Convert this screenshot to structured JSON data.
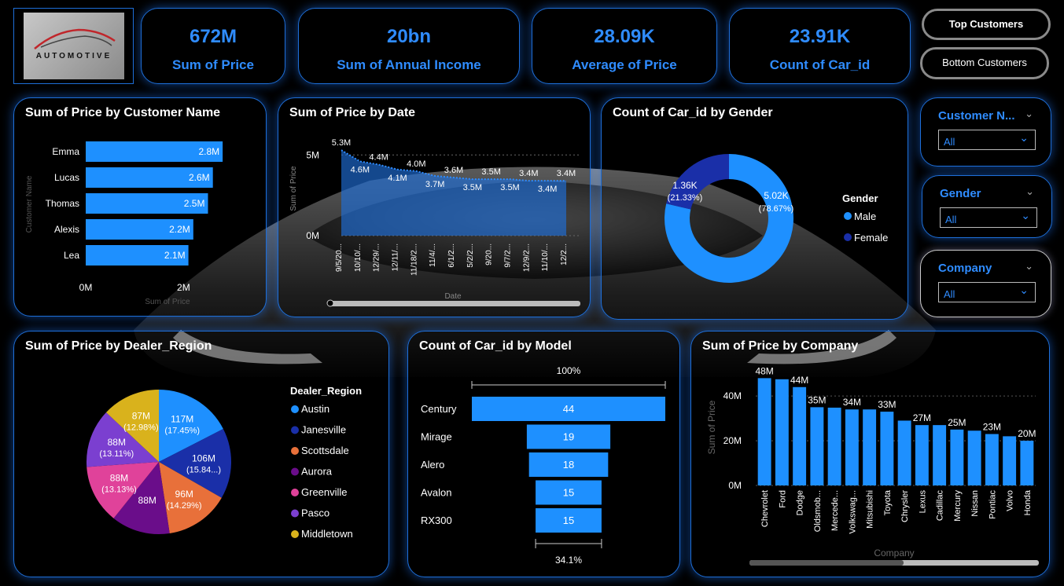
{
  "brand": {
    "logo_text": "AUTOMOTIVE"
  },
  "kpis": [
    {
      "value": "672M",
      "label": "Sum of Price"
    },
    {
      "value": "20bn",
      "label": "Sum of Annual Income"
    },
    {
      "value": "28.09K",
      "label": "Average of Price"
    },
    {
      "value": "23.91K",
      "label": "Count of Car_id"
    }
  ],
  "buttons": {
    "top_customers": "Top Customers",
    "bottom_customers": "Bottom Customers"
  },
  "slicers": [
    {
      "title": "Customer N...",
      "value": "All"
    },
    {
      "title": "Gender",
      "value": "All"
    },
    {
      "title": "Company",
      "value": "All"
    }
  ],
  "colors": {
    "accent": "#2f8cff",
    "bar": "#1e90ff",
    "border": "#1e6fd9"
  },
  "chart_data": [
    {
      "id": "customer",
      "type": "bar",
      "orientation": "horizontal",
      "title": "Sum of Price by Customer Name",
      "xlabel": "Sum of Price",
      "ylabel": "Customer Name",
      "categories": [
        "Emma",
        "Lucas",
        "Thomas",
        "Alexis",
        "Lea"
      ],
      "values": [
        2.8,
        2.6,
        2.5,
        2.2,
        2.1
      ],
      "labels": [
        "2.8M",
        "2.6M",
        "2.5M",
        "2.2M",
        "2.1M"
      ],
      "ticks": [
        "0M",
        "2M"
      ],
      "xlim": [
        0,
        3.2
      ]
    },
    {
      "id": "date",
      "type": "area",
      "title": "Sum of Price by Date",
      "xlabel": "Date",
      "ylabel": "Sum of Price",
      "values": [
        5.3,
        4.6,
        4.4,
        4.1,
        4.0,
        3.7,
        3.6,
        3.5,
        3.5,
        3.5,
        3.4,
        3.4,
        3.4
      ],
      "labels": [
        "5.3M",
        "4.6M",
        "4.4M",
        "4.1M",
        "4.0M",
        "3.7M",
        "3.6M",
        "3.5M",
        "3.5M",
        "3.5M",
        "3.4M",
        "3.4M",
        "3.4M"
      ],
      "x_ticks": [
        "9/5/20...",
        "10/10/...",
        "12/29/...",
        "12/11/...",
        "11/18/2...",
        "11/4/...",
        "6/1/2...",
        "5/2/2...",
        "9/20...",
        "9/7/2...",
        "12/9/2...",
        "11/10/...",
        "12/2..."
      ],
      "y_ticks": [
        "5M",
        "0M"
      ],
      "ylim": [
        0,
        5.5
      ]
    },
    {
      "id": "gender",
      "type": "pie",
      "variant": "donut",
      "title": "Count of Car_id by Gender",
      "legend_title": "Gender",
      "categories": [
        "Male",
        "Female"
      ],
      "values": [
        5.02,
        1.36
      ],
      "labels": [
        "5.02K",
        "1.36K"
      ],
      "percents": [
        "(78.67%)",
        "(21.33%)"
      ],
      "colors": [
        "#1e90ff",
        "#1a2fa8"
      ]
    },
    {
      "id": "region",
      "type": "pie",
      "title": "Sum of Price by Dealer_Region",
      "legend_title": "Dealer_Region",
      "categories": [
        "Austin",
        "Janesville",
        "Scottsdale",
        "Aurora",
        "Greenville",
        "Pasco",
        "Middletown"
      ],
      "values": [
        117,
        106,
        96,
        88,
        88,
        88,
        87
      ],
      "labels": [
        "117M",
        "106M",
        "96M",
        "88M",
        "88M",
        "88M",
        "87M"
      ],
      "percents": [
        "(17.45%)",
        "(15.84...)",
        "(14.29%)",
        "",
        "(13.13%)",
        "(13.11%)",
        "(12.98%)"
      ],
      "colors": [
        "#1e90ff",
        "#1a2fa8",
        "#e8703a",
        "#6a0d8a",
        "#e0429a",
        "#7b3fd0",
        "#d9b21c"
      ]
    },
    {
      "id": "model",
      "type": "bar",
      "variant": "funnel",
      "title": "Count of Car_id by Model",
      "categories": [
        "Century",
        "Mirage",
        "Alero",
        "Avalon",
        "RX300"
      ],
      "values": [
        44,
        19,
        18,
        15,
        15
      ],
      "top_label": "100%",
      "bottom_label": "34.1%"
    },
    {
      "id": "company",
      "type": "bar",
      "title": "Sum of Price by Company",
      "xlabel": "Company",
      "ylabel": "Sum of Price",
      "categories": [
        "Chevrolet",
        "Ford",
        "Dodge",
        "Oldsmob...",
        "Mercede...",
        "Volkswag...",
        "Mitsubishi",
        "Toyota",
        "Chrysler",
        "Lexus",
        "Cadillac",
        "Mercury",
        "Nissan",
        "Pontiac",
        "Volvo",
        "Honda"
      ],
      "values": [
        48,
        47.5,
        44,
        35,
        34.8,
        34,
        34,
        33,
        29,
        27,
        27,
        25,
        24.5,
        23,
        22,
        20
      ],
      "labels": [
        "48M",
        "",
        "44M",
        "35M",
        "",
        "34M",
        "",
        "33M",
        "",
        "27M",
        "",
        "25M",
        "",
        "23M",
        "",
        "20M"
      ],
      "y_ticks": [
        "40M",
        "20M",
        "0M"
      ],
      "ylim": [
        0,
        52
      ]
    }
  ]
}
